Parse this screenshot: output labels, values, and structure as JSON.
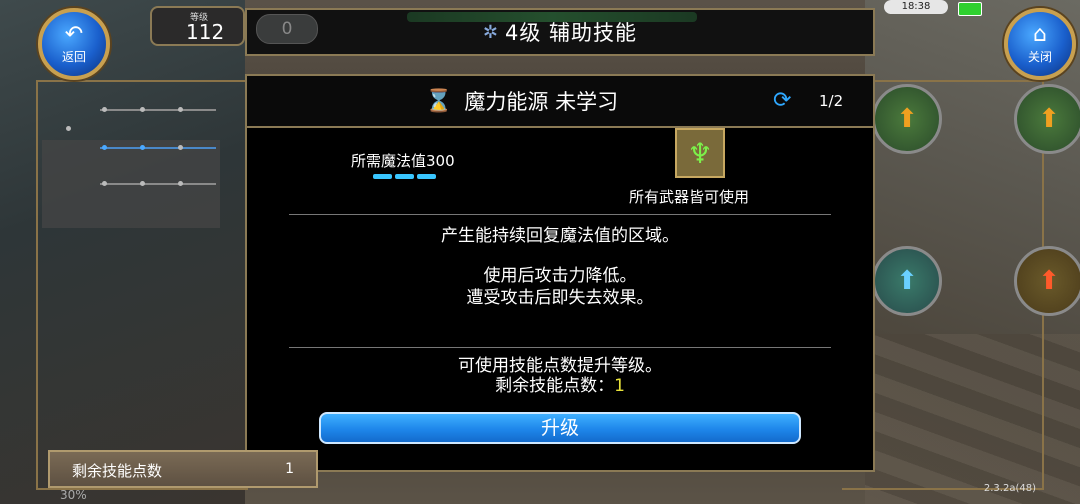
{
  "top_bar": {
    "level_label": "等级",
    "level_value": "112",
    "counter_value": "0",
    "title": "4级 辅助技能"
  },
  "buttons": {
    "back_label": "返回",
    "close_label": "关闭"
  },
  "status_bar": {
    "time": "18:38"
  },
  "dialog": {
    "skill_name": "魔力能源 未学习",
    "page_indicator": "1/2",
    "mp_requirement": "所需魔法值300",
    "weapon_text": "所有武器皆可使用",
    "description_line1": "产生能持续回复魔法值的区域。",
    "description_line2": "使用后攻击力降低。",
    "description_line3": "遭受攻击后即失去效果。",
    "upgrade_hint": "可使用技能点数提升等级。",
    "remaining_points_label": "剩余技能点数：",
    "remaining_points_value": "1",
    "upgrade_button_label": "升级"
  },
  "bottom_panel": {
    "label": "剩余技能点数",
    "count": "1",
    "percent": "30%"
  },
  "version": "2.3.2a(48)",
  "icons": {
    "back": "back-arrow-icon",
    "close": "home-icon",
    "title_sparkle": "sparkle-icon",
    "skill": "hourglass-icon",
    "refresh": "refresh-icon",
    "weapon": "person-icon"
  }
}
